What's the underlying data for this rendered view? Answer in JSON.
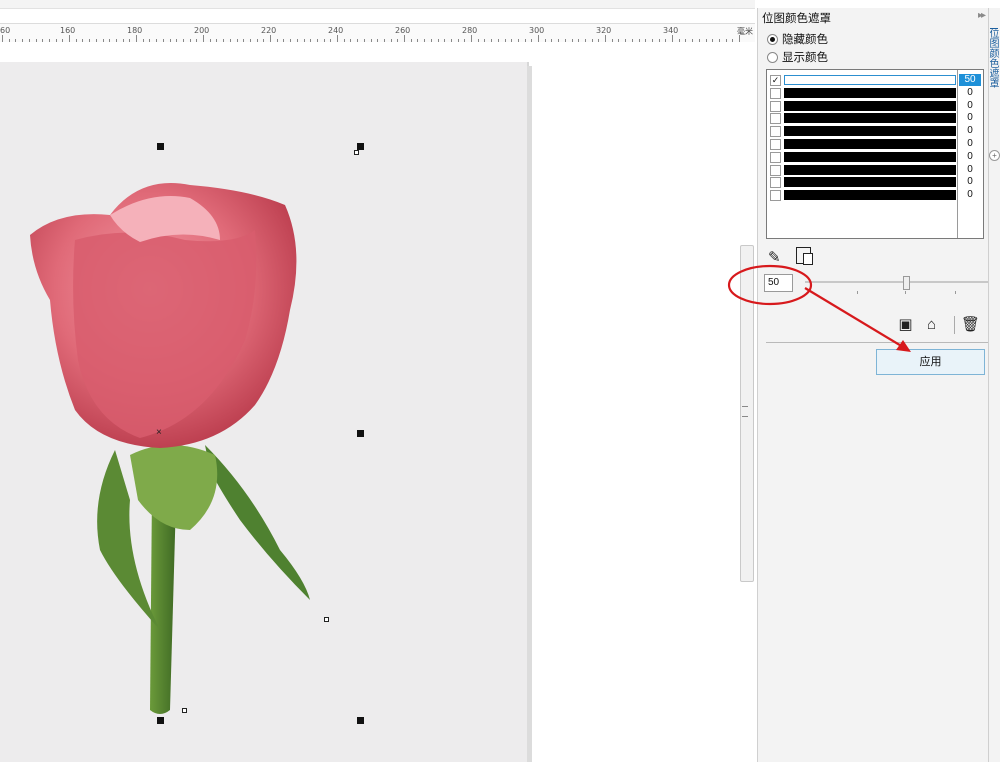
{
  "ruler": {
    "labels": [
      "60",
      "160",
      "180",
      "200",
      "220",
      "240",
      "260",
      "280",
      "300",
      "320",
      "340"
    ],
    "unit": "毫米"
  },
  "docker": {
    "title": "位图颜色遮罩",
    "collapse_icon": "double-chevron-right-icon",
    "radio_hide_label": "隐藏颜色",
    "radio_show_label": "显示颜色",
    "selected_mode": "隐藏颜色",
    "colors": [
      {
        "checked": true,
        "value": "50",
        "swatch": "#ffffff"
      },
      {
        "checked": false,
        "value": "0",
        "swatch": "#000000"
      },
      {
        "checked": false,
        "value": "0",
        "swatch": "#000000"
      },
      {
        "checked": false,
        "value": "0",
        "swatch": "#000000"
      },
      {
        "checked": false,
        "value": "0",
        "swatch": "#000000"
      },
      {
        "checked": false,
        "value": "0",
        "swatch": "#000000"
      },
      {
        "checked": false,
        "value": "0",
        "swatch": "#000000"
      },
      {
        "checked": false,
        "value": "0",
        "swatch": "#000000"
      },
      {
        "checked": false,
        "value": "0",
        "swatch": "#000000"
      },
      {
        "checked": false,
        "value": "0",
        "swatch": "#000000"
      }
    ],
    "check_mark": "✓",
    "tolerance_value": "50",
    "tolerance_fraction": 0.5,
    "apply_label": "应用",
    "icons": [
      "eyedropper-icon",
      "color-select-icon",
      "save-icon",
      "open-folder-icon",
      "delete-icon"
    ]
  },
  "vertical_tab": {
    "label": "位图颜色遮罩"
  },
  "colors": {
    "accent": "#1e90d8",
    "annotation": "#d7191c",
    "page": "#edeced"
  }
}
